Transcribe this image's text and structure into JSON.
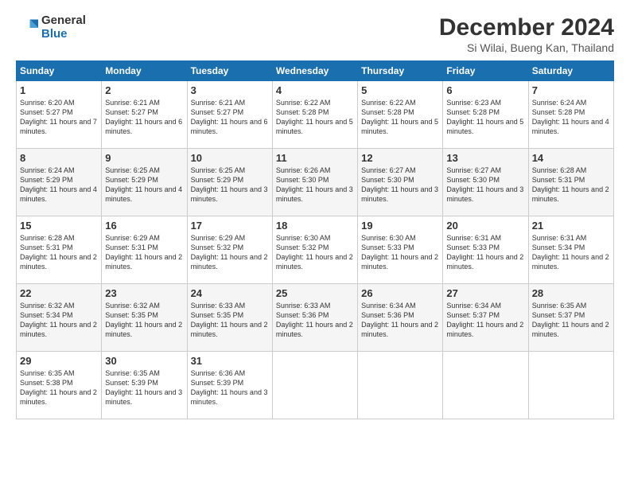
{
  "logo": {
    "general": "General",
    "blue": "Blue"
  },
  "header": {
    "month": "December 2024",
    "location": "Si Wilai, Bueng Kan, Thailand"
  },
  "weekdays": [
    "Sunday",
    "Monday",
    "Tuesday",
    "Wednesday",
    "Thursday",
    "Friday",
    "Saturday"
  ],
  "weeks": [
    [
      {
        "day": "1",
        "sunrise": "6:20 AM",
        "sunset": "5:27 PM",
        "daylight": "11 hours and 7 minutes."
      },
      {
        "day": "2",
        "sunrise": "6:21 AM",
        "sunset": "5:27 PM",
        "daylight": "11 hours and 6 minutes."
      },
      {
        "day": "3",
        "sunrise": "6:21 AM",
        "sunset": "5:27 PM",
        "daylight": "11 hours and 6 minutes."
      },
      {
        "day": "4",
        "sunrise": "6:22 AM",
        "sunset": "5:28 PM",
        "daylight": "11 hours and 5 minutes."
      },
      {
        "day": "5",
        "sunrise": "6:22 AM",
        "sunset": "5:28 PM",
        "daylight": "11 hours and 5 minutes."
      },
      {
        "day": "6",
        "sunrise": "6:23 AM",
        "sunset": "5:28 PM",
        "daylight": "11 hours and 5 minutes."
      },
      {
        "day": "7",
        "sunrise": "6:24 AM",
        "sunset": "5:28 PM",
        "daylight": "11 hours and 4 minutes."
      }
    ],
    [
      {
        "day": "8",
        "sunrise": "6:24 AM",
        "sunset": "5:29 PM",
        "daylight": "11 hours and 4 minutes."
      },
      {
        "day": "9",
        "sunrise": "6:25 AM",
        "sunset": "5:29 PM",
        "daylight": "11 hours and 4 minutes."
      },
      {
        "day": "10",
        "sunrise": "6:25 AM",
        "sunset": "5:29 PM",
        "daylight": "11 hours and 3 minutes."
      },
      {
        "day": "11",
        "sunrise": "6:26 AM",
        "sunset": "5:30 PM",
        "daylight": "11 hours and 3 minutes."
      },
      {
        "day": "12",
        "sunrise": "6:27 AM",
        "sunset": "5:30 PM",
        "daylight": "11 hours and 3 minutes."
      },
      {
        "day": "13",
        "sunrise": "6:27 AM",
        "sunset": "5:30 PM",
        "daylight": "11 hours and 3 minutes."
      },
      {
        "day": "14",
        "sunrise": "6:28 AM",
        "sunset": "5:31 PM",
        "daylight": "11 hours and 2 minutes."
      }
    ],
    [
      {
        "day": "15",
        "sunrise": "6:28 AM",
        "sunset": "5:31 PM",
        "daylight": "11 hours and 2 minutes."
      },
      {
        "day": "16",
        "sunrise": "6:29 AM",
        "sunset": "5:31 PM",
        "daylight": "11 hours and 2 minutes."
      },
      {
        "day": "17",
        "sunrise": "6:29 AM",
        "sunset": "5:32 PM",
        "daylight": "11 hours and 2 minutes."
      },
      {
        "day": "18",
        "sunrise": "6:30 AM",
        "sunset": "5:32 PM",
        "daylight": "11 hours and 2 minutes."
      },
      {
        "day": "19",
        "sunrise": "6:30 AM",
        "sunset": "5:33 PM",
        "daylight": "11 hours and 2 minutes."
      },
      {
        "day": "20",
        "sunrise": "6:31 AM",
        "sunset": "5:33 PM",
        "daylight": "11 hours and 2 minutes."
      },
      {
        "day": "21",
        "sunrise": "6:31 AM",
        "sunset": "5:34 PM",
        "daylight": "11 hours and 2 minutes."
      }
    ],
    [
      {
        "day": "22",
        "sunrise": "6:32 AM",
        "sunset": "5:34 PM",
        "daylight": "11 hours and 2 minutes."
      },
      {
        "day": "23",
        "sunrise": "6:32 AM",
        "sunset": "5:35 PM",
        "daylight": "11 hours and 2 minutes."
      },
      {
        "day": "24",
        "sunrise": "6:33 AM",
        "sunset": "5:35 PM",
        "daylight": "11 hours and 2 minutes."
      },
      {
        "day": "25",
        "sunrise": "6:33 AM",
        "sunset": "5:36 PM",
        "daylight": "11 hours and 2 minutes."
      },
      {
        "day": "26",
        "sunrise": "6:34 AM",
        "sunset": "5:36 PM",
        "daylight": "11 hours and 2 minutes."
      },
      {
        "day": "27",
        "sunrise": "6:34 AM",
        "sunset": "5:37 PM",
        "daylight": "11 hours and 2 minutes."
      },
      {
        "day": "28",
        "sunrise": "6:35 AM",
        "sunset": "5:37 PM",
        "daylight": "11 hours and 2 minutes."
      }
    ],
    [
      {
        "day": "29",
        "sunrise": "6:35 AM",
        "sunset": "5:38 PM",
        "daylight": "11 hours and 2 minutes."
      },
      {
        "day": "30",
        "sunrise": "6:35 AM",
        "sunset": "5:39 PM",
        "daylight": "11 hours and 3 minutes."
      },
      {
        "day": "31",
        "sunrise": "6:36 AM",
        "sunset": "5:39 PM",
        "daylight": "11 hours and 3 minutes."
      },
      null,
      null,
      null,
      null
    ]
  ],
  "labels": {
    "sunrise": "Sunrise:",
    "sunset": "Sunset:",
    "daylight": "Daylight:"
  }
}
